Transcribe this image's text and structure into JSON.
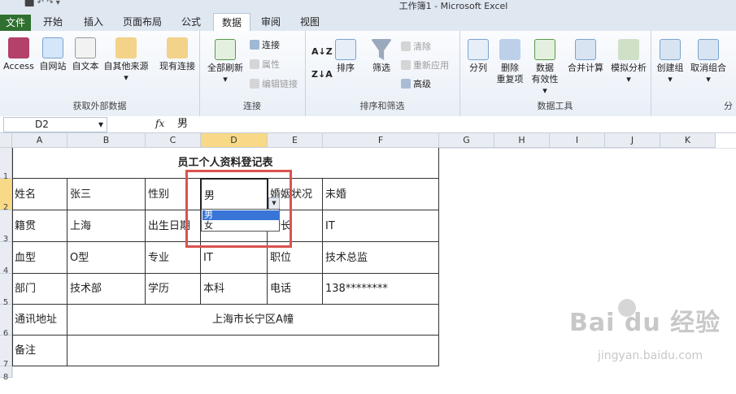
{
  "window": {
    "title": "工作簿1 - Microsoft Excel",
    "qat": "⬛ ↶ ↷ ▾"
  },
  "tabs": [
    "文件",
    "开始",
    "插入",
    "页面布局",
    "公式",
    "数据",
    "审阅",
    "视图"
  ],
  "ribbon": {
    "external": {
      "access": "Access",
      "web": "自网站",
      "text": "自文本",
      "other": "自其他来源",
      "existing": "现有连接",
      "label": "获取外部数据"
    },
    "connections": {
      "refresh_all": "全部刷新",
      "connections": "连接",
      "properties": "属性",
      "edit_links": "编辑链接",
      "label": "连接"
    },
    "sort": {
      "sort_az": "A↓Z",
      "sort_za": "Z↓A",
      "sort": "排序",
      "filter": "筛选",
      "clear": "清除",
      "reapply": "重新应用",
      "advanced": "高级",
      "label": "排序和筛选"
    },
    "tools": {
      "text_to_cols": "分列",
      "remove_dup_1": "删除",
      "remove_dup_2": "重复项",
      "validation_1": "数据",
      "validation_2": "有效性",
      "consolidate": "合并计算",
      "whatif": "模拟分析",
      "label": "数据工具"
    },
    "outline": {
      "group": "创建组",
      "ungroup": "取消组合",
      "label": "分"
    }
  },
  "formula_bar": {
    "cell_ref": "D2",
    "fx": "fx",
    "content": "男"
  },
  "columns": [
    "A",
    "B",
    "C",
    "D",
    "E",
    "F",
    "G",
    "H",
    "I",
    "J",
    "K"
  ],
  "rows": [
    "1",
    "2",
    "3",
    "4",
    "5",
    "6",
    "7",
    "8"
  ],
  "sheet": {
    "title": "员工个人资料登记表",
    "r2": [
      "姓名",
      "张三",
      "性别",
      "男",
      "婚姻状况",
      "未婚"
    ],
    "r3": [
      "籍贯",
      "上海",
      "出生日期",
      "",
      "特长",
      "IT"
    ],
    "r4": [
      "血型",
      "O型",
      "专业",
      "IT",
      "职位",
      "技术总监"
    ],
    "r5": [
      "部门",
      "技术部",
      "学历",
      "本科",
      "电话",
      "138********"
    ],
    "r6": [
      "通讯地址",
      "上海市长宁区A幢"
    ],
    "r7": [
      "备注",
      ""
    ]
  },
  "dropdown": {
    "options": [
      "男",
      "女"
    ],
    "selected": "男"
  },
  "watermark": {
    "brand": "Bai du 经验",
    "url": "jingyan.baidu.com"
  },
  "colors": {
    "file_tab": "#2f6f2f",
    "selection_header": "#f8d987",
    "highlight": "#d9534f",
    "list_select": "#3875d7"
  }
}
